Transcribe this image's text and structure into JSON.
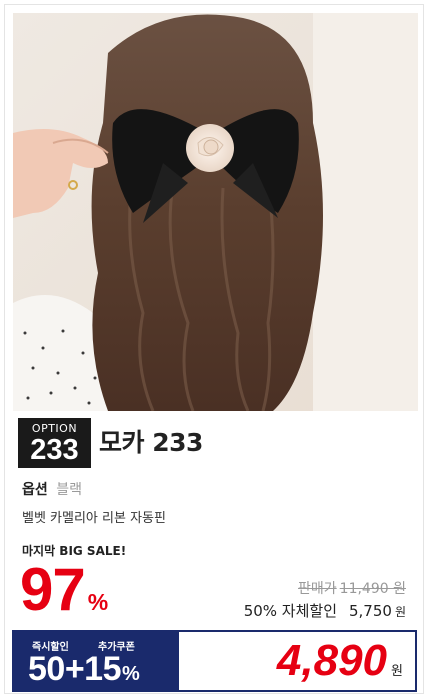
{
  "option": {
    "label": "OPTION",
    "number": "233"
  },
  "product": {
    "name": "모카 233",
    "option_label": "옵션",
    "option_value": "블랙",
    "description": "벨벳 카멜리아 리본 자동핀"
  },
  "sale": {
    "tag": "마지막 BIG SALE!",
    "discount_value": "97",
    "discount_unit": "%",
    "original_label": "판매가",
    "original_price": "11,490 원",
    "self_discount": "50% 자체할인",
    "self_price": "5,750",
    "self_price_unit": "원"
  },
  "coupon": {
    "instant_label": "즉시할인",
    "extra_label": "추가쿠폰",
    "combo": "50+15",
    "combo_unit": "%"
  },
  "final_price": {
    "value": "4,890",
    "unit": "원"
  },
  "colors": {
    "accent": "#e60012",
    "navy": "#1a2a6c"
  }
}
